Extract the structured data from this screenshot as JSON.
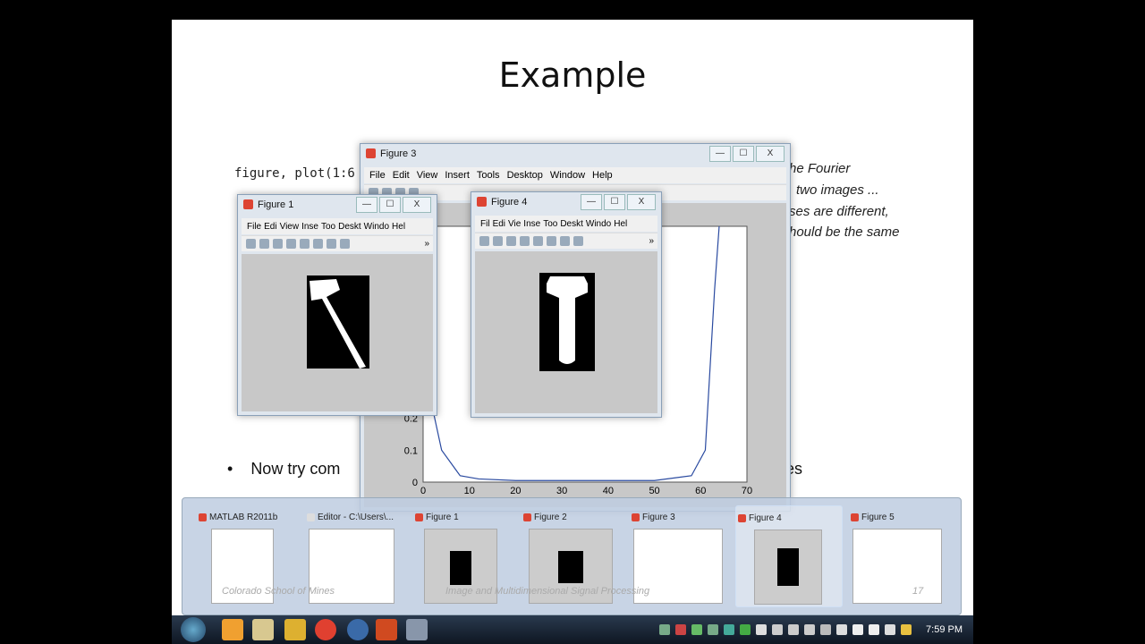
{
  "slide": {
    "title": "Example",
    "code": "figure, plot(1:6",
    "right_text": [
      "he Fourier",
      "two images ...",
      "ses are different,",
      "hould be the same"
    ],
    "bullet": "Now try com",
    "bullet_end": "es",
    "footer_left": "Colorado School of Mines",
    "footer_center": "Image and Multidimensional Signal Processing",
    "page_number": "17"
  },
  "figure3": {
    "title": "Figure 3",
    "menu": [
      "File",
      "Edit",
      "View",
      "Insert",
      "Tools",
      "Desktop",
      "Window",
      "Help"
    ],
    "chart_data": {
      "type": "line",
      "x_ticks": [
        "0",
        "10",
        "20",
        "30",
        "40",
        "50",
        "60",
        "70"
      ],
      "y_ticks": [
        "0",
        "0.1",
        "0.2"
      ],
      "xlim": [
        0,
        70
      ],
      "series": [
        {
          "x": [
            1,
            4,
            8,
            12,
            20,
            30,
            40,
            50,
            58,
            61,
            63,
            64
          ],
          "y": [
            0.3,
            0.1,
            0.02,
            0.01,
            0.005,
            0.005,
            0.005,
            0.005,
            0.02,
            0.1,
            0.6,
            0.8
          ]
        }
      ]
    }
  },
  "figure1": {
    "title": "Figure 1",
    "menu": [
      "File",
      "Edi",
      "View",
      "Inse",
      "Too",
      "Deskt",
      "Windo",
      "Hel"
    ]
  },
  "figure4": {
    "title": "Figure 4",
    "menu": [
      "Fil",
      "Edi",
      "Vie",
      "Inse",
      "Too",
      "Deskt",
      "Windo",
      "Hel"
    ]
  },
  "taskbar_preview": [
    {
      "label": "MATLAB  R2011b"
    },
    {
      "label": "Editor - C:\\Users\\..."
    },
    {
      "label": "Figure 1"
    },
    {
      "label": "Figure 2"
    },
    {
      "label": "Figure 3"
    },
    {
      "label": "Figure 4"
    },
    {
      "label": "Figure 5"
    }
  ],
  "clock": "7:59 PM",
  "win_buttons": {
    "min": "—",
    "max": "☐",
    "close": "X"
  },
  "toolbar_more": "»"
}
